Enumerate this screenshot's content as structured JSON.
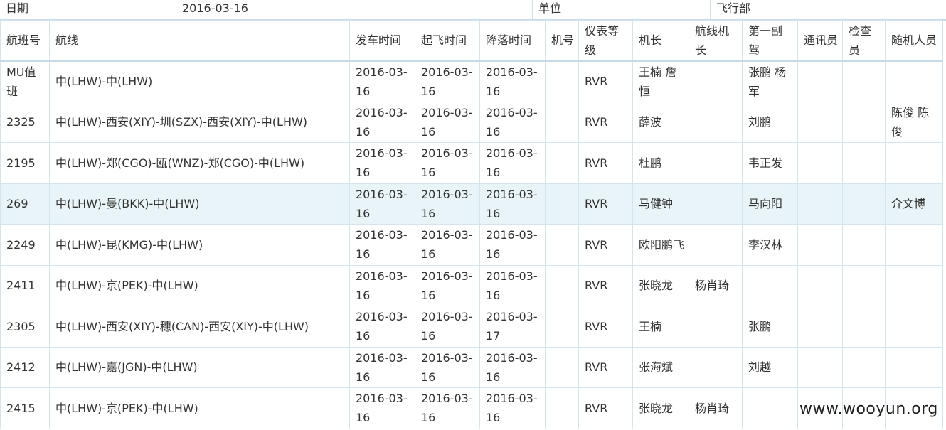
{
  "meta": {
    "date_label": "日期",
    "date_value": "2016-03-16",
    "unit_label": "单位",
    "unit_value": "飞行部"
  },
  "columns": [
    "航班号",
    "航线",
    "发车时间",
    "起飞时间",
    "降落时间",
    "机号",
    "仪表等级",
    "机长",
    "航线机长",
    "第一副驾",
    "通讯员",
    "检查员",
    "随机人员"
  ],
  "rows": [
    [
      "MU值班",
      "中(LHW)-中(LHW)",
      "2016-03-16",
      "2016-03-16",
      "2016-03-16",
      "",
      "RVR",
      "王楠 詹恒",
      "",
      "张鹏 杨军",
      "",
      "",
      ""
    ],
    [
      "2325",
      "中(LHW)-西安(XIY)-圳(SZX)-西安(XIY)-中(LHW)",
      "2016-03-16",
      "2016-03-16",
      "2016-03-16",
      "",
      "RVR",
      "薛波",
      "",
      "刘鹏",
      "",
      "",
      "陈俊 陈俊"
    ],
    [
      "2195",
      "中(LHW)-郑(CGO)-瓯(WNZ)-郑(CGO)-中(LHW)",
      "2016-03-16",
      "2016-03-16",
      "2016-03-16",
      "",
      "RVR",
      "杜鹏",
      "",
      "韦正发",
      "",
      "",
      ""
    ],
    [
      "269",
      "中(LHW)-曼(BKK)-中(LHW)",
      "2016-03-16",
      "2016-03-16",
      "2016-03-16",
      "",
      "RVR",
      "马健钟",
      "",
      "马向阳",
      "",
      "",
      "介文博"
    ],
    [
      "2249",
      "中(LHW)-昆(KMG)-中(LHW)",
      "2016-03-16",
      "2016-03-16",
      "2016-03-16",
      "",
      "RVR",
      "欧阳鹏飞",
      "",
      "李汉林",
      "",
      "",
      ""
    ],
    [
      "2411",
      "中(LHW)-京(PEK)-中(LHW)",
      "2016-03-16",
      "2016-03-16",
      "2016-03-16",
      "",
      "RVR",
      "张晓龙",
      "杨肖琦",
      "",
      "",
      "",
      ""
    ],
    [
      "2305",
      "中(LHW)-西安(XIY)-穗(CAN)-西安(XIY)-中(LHW)",
      "2016-03-16",
      "2016-03-16",
      "2016-03-17",
      "",
      "RVR",
      "王楠",
      "",
      "张鹏",
      "",
      "",
      ""
    ],
    [
      "2412",
      "中(LHW)-嘉(JGN)-中(LHW)",
      "2016-03-16",
      "2016-03-16",
      "2016-03-16",
      "",
      "RVR",
      "张海斌",
      "",
      "刘越",
      "",
      "",
      ""
    ],
    [
      "2415",
      "中(LHW)-京(PEK)-中(LHW)",
      "2016-03-16",
      "2016-03-16",
      "2016-03-16",
      "",
      "RVR",
      "张晓龙",
      "杨肖琦",
      "",
      "",
      "",
      ""
    ]
  ],
  "highlighted_row_index": 3,
  "watermark": "www.wooyun.org",
  "colors": {
    "border": "#d6e4ee",
    "header_rule": "#c5dbe8",
    "row_highlight": "#e8f4f8",
    "text": "#333333"
  }
}
